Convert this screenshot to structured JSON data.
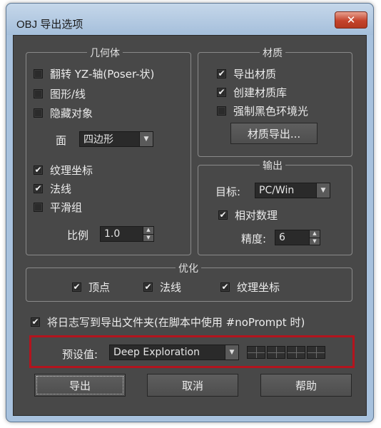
{
  "window": {
    "title": "OBJ 导出选项",
    "close_label": "✕"
  },
  "geometry": {
    "title": "几何体",
    "flip_yz": {
      "label": "翻转 YZ-轴(Poser-状)",
      "checked": false
    },
    "shapes_lines": {
      "label": "图形/线",
      "checked": false
    },
    "hidden_objects": {
      "label": "隐藏对象",
      "checked": false
    },
    "face_label": "面",
    "face_value": "四边形",
    "texture_coords": {
      "label": "纹理坐标",
      "checked": true
    },
    "normals": {
      "label": "法线",
      "checked": true
    },
    "smoothing_groups": {
      "label": "平滑组",
      "checked": false
    },
    "scale_label": "比例",
    "scale_value": "1.0"
  },
  "material": {
    "title": "材质",
    "export_materials": {
      "label": "导出材质",
      "checked": true
    },
    "create_library": {
      "label": "创建材质库",
      "checked": true
    },
    "force_black_ambient": {
      "label": "强制黑色环境光",
      "checked": false
    },
    "export_button": "材质导出..."
  },
  "output": {
    "title": "输出",
    "target_label": "目标:",
    "target_value": "PC/Win",
    "relative_numbers": {
      "label": "相对数理",
      "checked": true
    },
    "precision_label": "精度:",
    "precision_value": "6"
  },
  "optimize": {
    "title": "优化",
    "vertices": {
      "label": "顶点",
      "checked": true
    },
    "normals": {
      "label": "法线",
      "checked": true
    },
    "texture_coords": {
      "label": "纹理坐标",
      "checked": true
    }
  },
  "log": {
    "label": "将日志写到导出文件夹(在脚本中使用 #noPrompt 时)",
    "checked": true
  },
  "preset": {
    "label": "预设值:",
    "value": "Deep Exploration"
  },
  "buttons": {
    "export": "导出",
    "cancel": "取消",
    "help": "帮助"
  },
  "check_glyph": "✔",
  "colors": {
    "highlight": "#b3141e",
    "panel_bg": "#484848",
    "window_frame": "#a8c2de"
  }
}
